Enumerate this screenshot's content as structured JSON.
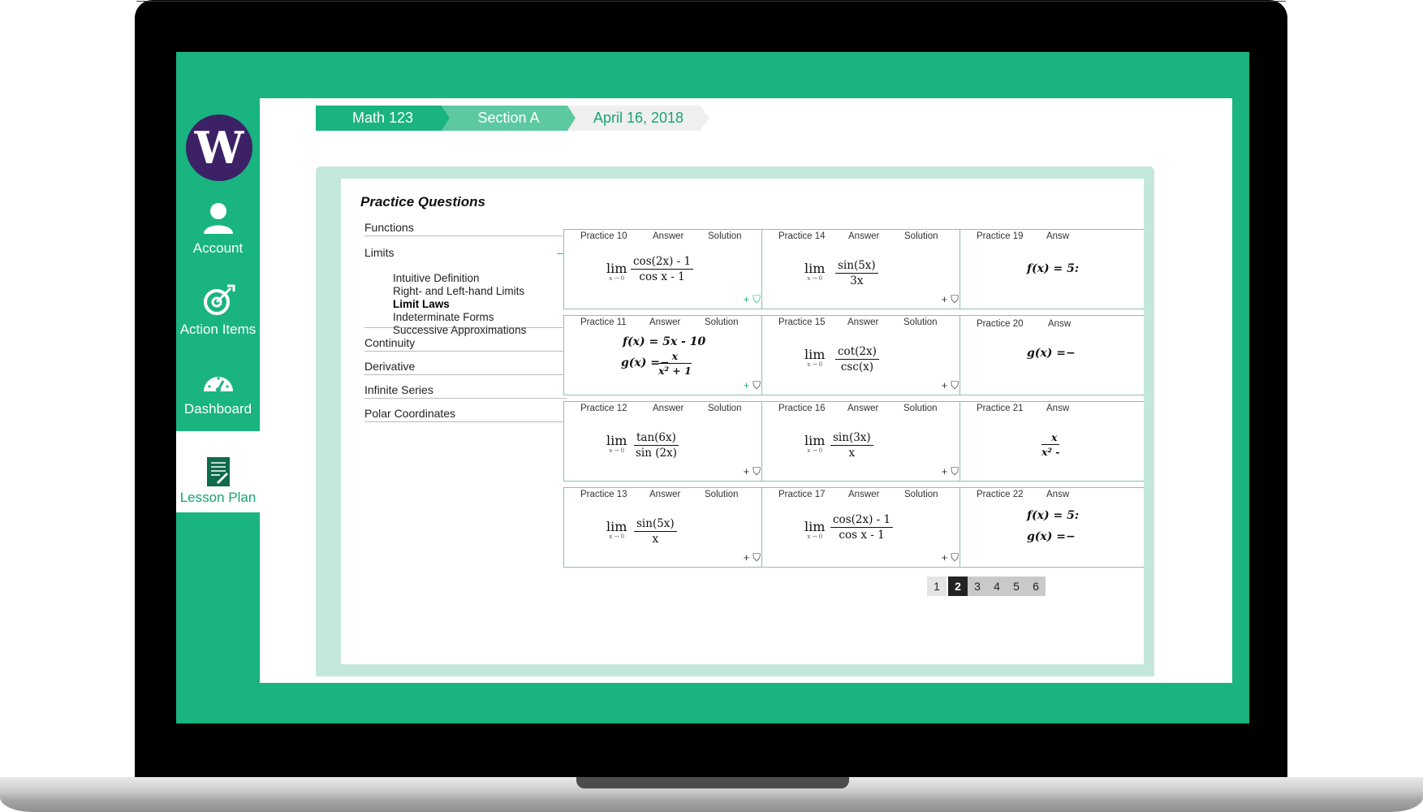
{
  "sidebar": {
    "logo": "W",
    "items": [
      {
        "label": "Account",
        "icon": "person-icon"
      },
      {
        "label": "Action Items",
        "icon": "target-icon"
      },
      {
        "label": "Dashboard",
        "icon": "gauge-icon"
      },
      {
        "label": "Lesson Plan",
        "icon": "document-icon",
        "active": true
      }
    ]
  },
  "breadcrumb": {
    "course": "Math 123",
    "section": "Section A",
    "date": "April 16, 2018"
  },
  "practice": {
    "title": "Practice Questions",
    "topics": {
      "functions": "Functions",
      "limits": "Limits",
      "limits_toggle": "–",
      "limits_sub": [
        "Intuitive Definition",
        "Right- and Left-hand Limits",
        "Limit Laws",
        "Indeterminate Forms",
        "Successive Approximations"
      ],
      "continuity": "Continuity",
      "derivative": "Derivative",
      "infinite_series": "Infinite Series",
      "polar_coordinates": "Polar Coordinates"
    },
    "card_labels": {
      "answer": "Answer",
      "solution": "Solution",
      "add": "+",
      "bookmark": "⛉"
    },
    "cards": [
      {
        "name": "Practice 10",
        "lim": "lim",
        "sub": "x → 0",
        "num": "cos(2x) - 1",
        "den": "cos x - 1"
      },
      {
        "name": "Practice 11",
        "f": "f(x) = 5x - 10",
        "g": "g(x) =−",
        "gnum": "x",
        "gden": "x² + 1"
      },
      {
        "name": "Practice 12",
        "lim": "lim",
        "sub": "x → 0",
        "num": "tan(6x)",
        "den": "sin (2x)"
      },
      {
        "name": "Practice 13",
        "lim": "lim",
        "sub": "x → 0",
        "num": "sin(5x)",
        "den": "x"
      },
      {
        "name": "Practice 14",
        "lim": "lim",
        "sub": "x → 0",
        "num": "sin(5x)",
        "den": "3x"
      },
      {
        "name": "Practice 15",
        "lim": "lim",
        "sub": "x → 0",
        "num": "cot(2x)",
        "den": "csc(x)"
      },
      {
        "name": "Practice 16",
        "lim": "lim",
        "sub": "x → 0",
        "num": "sin(3x)",
        "den": "x"
      },
      {
        "name": "Practice 17",
        "lim": "lim",
        "sub": "x → 0",
        "num": "cos(2x) - 1",
        "den": "cos x - 1"
      },
      {
        "name": "Practice 19",
        "answer": "Answ",
        "f": "f(x) = 5:"
      },
      {
        "name": "Practice 20",
        "answer": "Answ",
        "g": "g(x) =−"
      },
      {
        "name": "Practice 21",
        "answer": "Answ",
        "gnum": "x",
        "gden": "x² -"
      },
      {
        "name": "Practice 22",
        "answer": "Answ",
        "f": "f(x) = 5:",
        "g": "g(x) =−"
      }
    ],
    "pages": [
      "1",
      "2",
      "3",
      "4",
      "5",
      "6"
    ],
    "current_page": "2"
  },
  "colors": {
    "brand_green": "#19b47f",
    "logo_purple": "#3d2166",
    "panel_mint": "#c3e8da"
  }
}
